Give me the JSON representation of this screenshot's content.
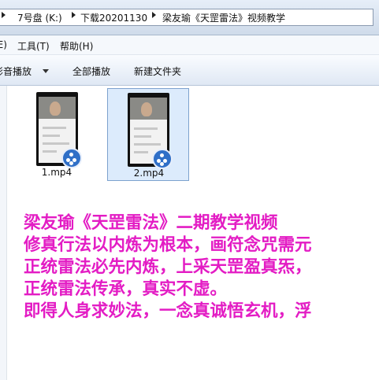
{
  "breadcrumb": {
    "items": [
      "7号盘 (K:)",
      "下载20201130",
      "梁友瑜《天罡雷法》视频教学"
    ]
  },
  "menubar": {
    "items": [
      "(E)",
      "工具(T)",
      "帮助(H)"
    ]
  },
  "toolbar": {
    "play_label": "影音播放",
    "play_all_label": "全部播放",
    "new_folder_label": "新建文件夹"
  },
  "files": [
    {
      "name": "1.mp4",
      "selected": false
    },
    {
      "name": "2.mp4",
      "selected": true
    }
  ],
  "caption": {
    "color": "#e31cc4",
    "lines": [
      "梁友瑜《天罡雷法》二期教学视频",
      "修真行法以内炼为根本，画符念咒需元",
      "正统雷法必先内炼，上采天罡盈真炁，",
      "正统雷法传承，真实不虚。",
      "即得人身求妙法，一念真诚悟玄机，浮"
    ]
  }
}
